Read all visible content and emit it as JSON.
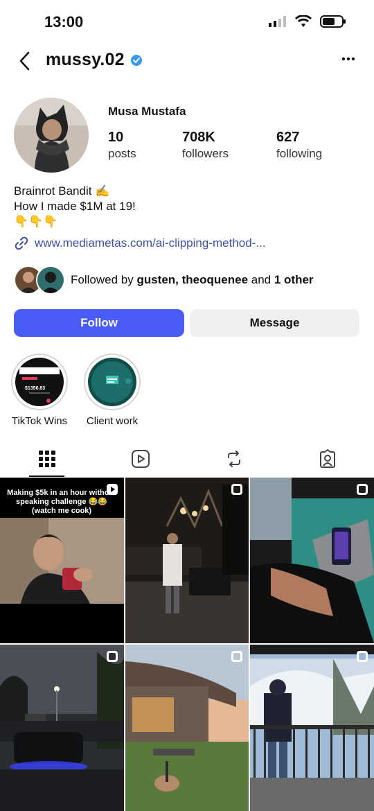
{
  "status_bar": {
    "time": "13:00"
  },
  "header": {
    "username": "mussy.02"
  },
  "profile": {
    "display_name": "Musa Mustafa",
    "stats": [
      {
        "value": "10",
        "label": "posts"
      },
      {
        "value": "708K",
        "label": "followers"
      },
      {
        "value": "627",
        "label": "following"
      }
    ],
    "bio_lines": [
      "Brainrot Bandit ✍️",
      "How I made $1M at 19!",
      "👇👇👇"
    ],
    "link": "www.mediametas.com/ai-clipping-method-...",
    "followed_by": {
      "prefix": "Followed by ",
      "name1": "gusten",
      "sep": ", ",
      "name2": "theoquenee",
      "and": " and ",
      "other": "1 other"
    }
  },
  "actions": {
    "follow": "Follow",
    "message": "Message"
  },
  "highlights": [
    {
      "label": "TikTok Wins",
      "thumb_amount": "$1356.83"
    },
    {
      "label": "Client work"
    }
  ],
  "tabs": [
    "grid",
    "reels",
    "reposts",
    "tagged"
  ],
  "posts": [
    {
      "overlay_text": "Making $5k in an hour without speaking challenge 😂😂 (watch me cook)"
    },
    {},
    {},
    {},
    {},
    {}
  ],
  "colors": {
    "accent": "#4a5cf6",
    "link": "#3e4fa3",
    "verified": "#3897f0"
  }
}
